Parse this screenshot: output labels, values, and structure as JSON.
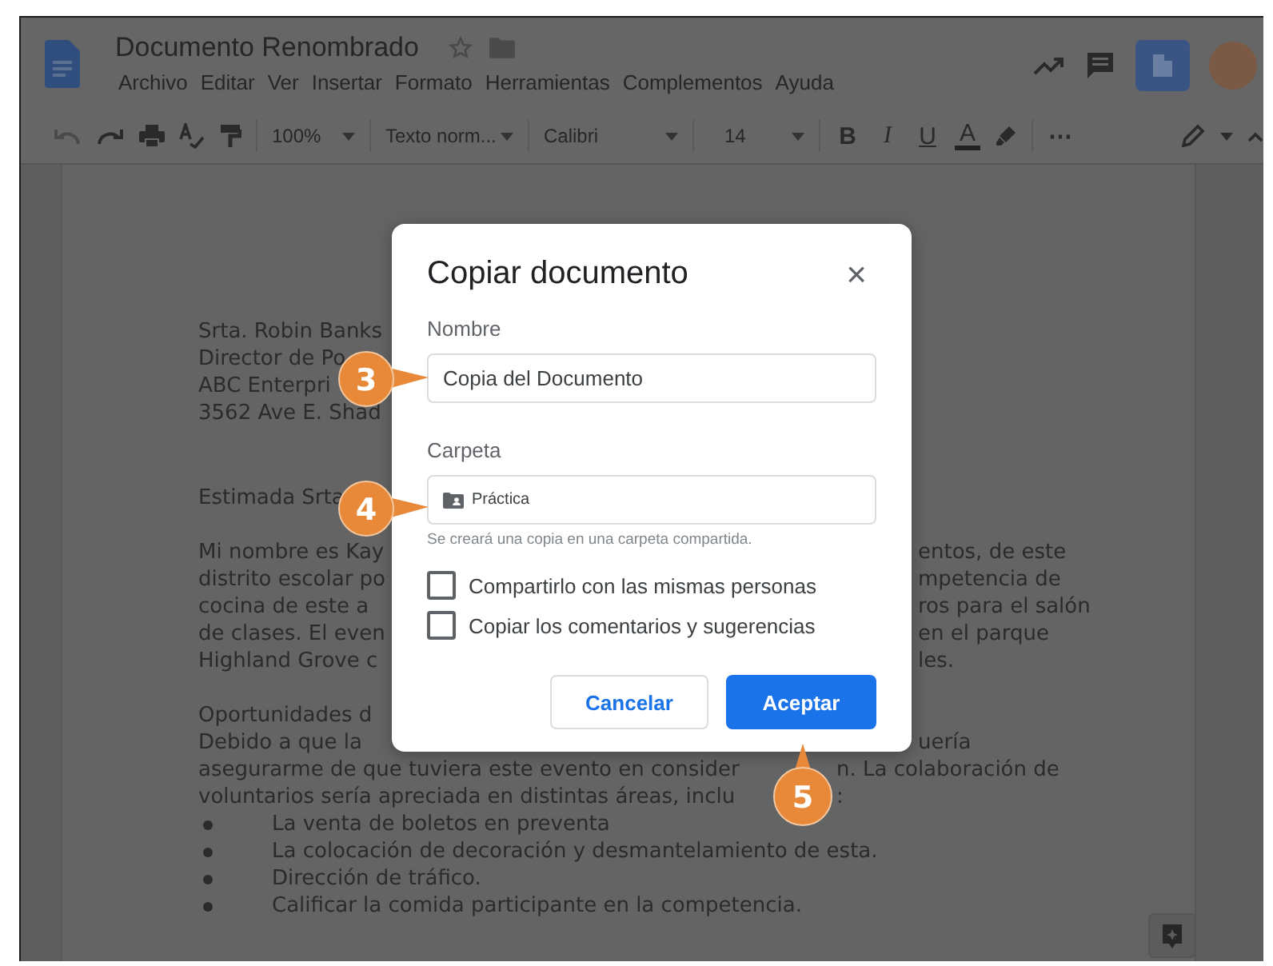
{
  "window": {
    "doc_title": "Documento Renombrado",
    "menu": [
      "Archivo",
      "Editar",
      "Ver",
      "Insertar",
      "Formato",
      "Herramientas",
      "Complementos",
      "Ayuda"
    ]
  },
  "toolbar": {
    "zoom": "100%",
    "style": "Texto norm...",
    "font": "Calibri",
    "size": "14",
    "bold": "B",
    "italic": "I",
    "underline": "U",
    "text_color": "A",
    "more": "⋯"
  },
  "document": {
    "paragraphs": [
      {
        "lines": [
          {
            "left": "Srta. Robin Banks"
          },
          {
            "left": "Director de Po"
          },
          {
            "left": "ABC Enterpri"
          },
          {
            "left": "3562 Ave E. Shad"
          }
        ]
      },
      {
        "lines": [
          {
            "left": "Estimada Srta"
          }
        ]
      },
      {
        "lines": [
          {
            "left": "Mi nombre es Kay",
            "right": "entos, de este",
            "kind": "behind_dialog"
          },
          {
            "left": "distrito escolar po",
            "right": "mpetencia de",
            "kind": "behind_dialog"
          },
          {
            "left": "cocina de este a",
            "right": "ros para el salón",
            "kind": "behind_dialog"
          },
          {
            "left": "de clases. El even",
            "right": "en el parque",
            "kind": "behind_dialog"
          },
          {
            "left": "Highland Grove c",
            "right": "les.",
            "kind": "behind_dialog"
          }
        ]
      },
      {
        "lines": [
          {
            "left": "Oportunidades d"
          },
          {
            "left": "Debido a que la",
            "right": "uería",
            "kind": "behind_dialog"
          },
          {
            "left": "asegurarme de que tuviera este evento en consider",
            "right": "n. La colaboración de",
            "kind": "behind_callout"
          },
          {
            "left": "voluntarios sería apreciada en distintas áreas, inclu",
            "right": ":",
            "kind": "behind_callout"
          }
        ],
        "bullets": [
          "La venta de boletos en preventa",
          "La colocación de decoración y desmantelamiento de esta.",
          "Dirección de tráfico.",
          "Calificar la comida participante en la competencia."
        ]
      }
    ]
  },
  "dialog": {
    "title": "Copiar documento",
    "close": "×",
    "name_label": "Nombre",
    "name_value": "Copia del Documento",
    "folder_label": "Carpeta",
    "folder_value": "Práctica",
    "folder_hint": "Se creará una copia en una carpeta compartida.",
    "options": [
      {
        "label": "Compartirlo con las mismas personas",
        "checked": false
      },
      {
        "label": "Copiar los comentarios y sugerencias",
        "checked": false
      }
    ],
    "cancel": "Cancelar",
    "accept": "Aceptar"
  },
  "callouts": [
    {
      "number": "3"
    },
    {
      "number": "4"
    },
    {
      "number": "5"
    }
  ]
}
